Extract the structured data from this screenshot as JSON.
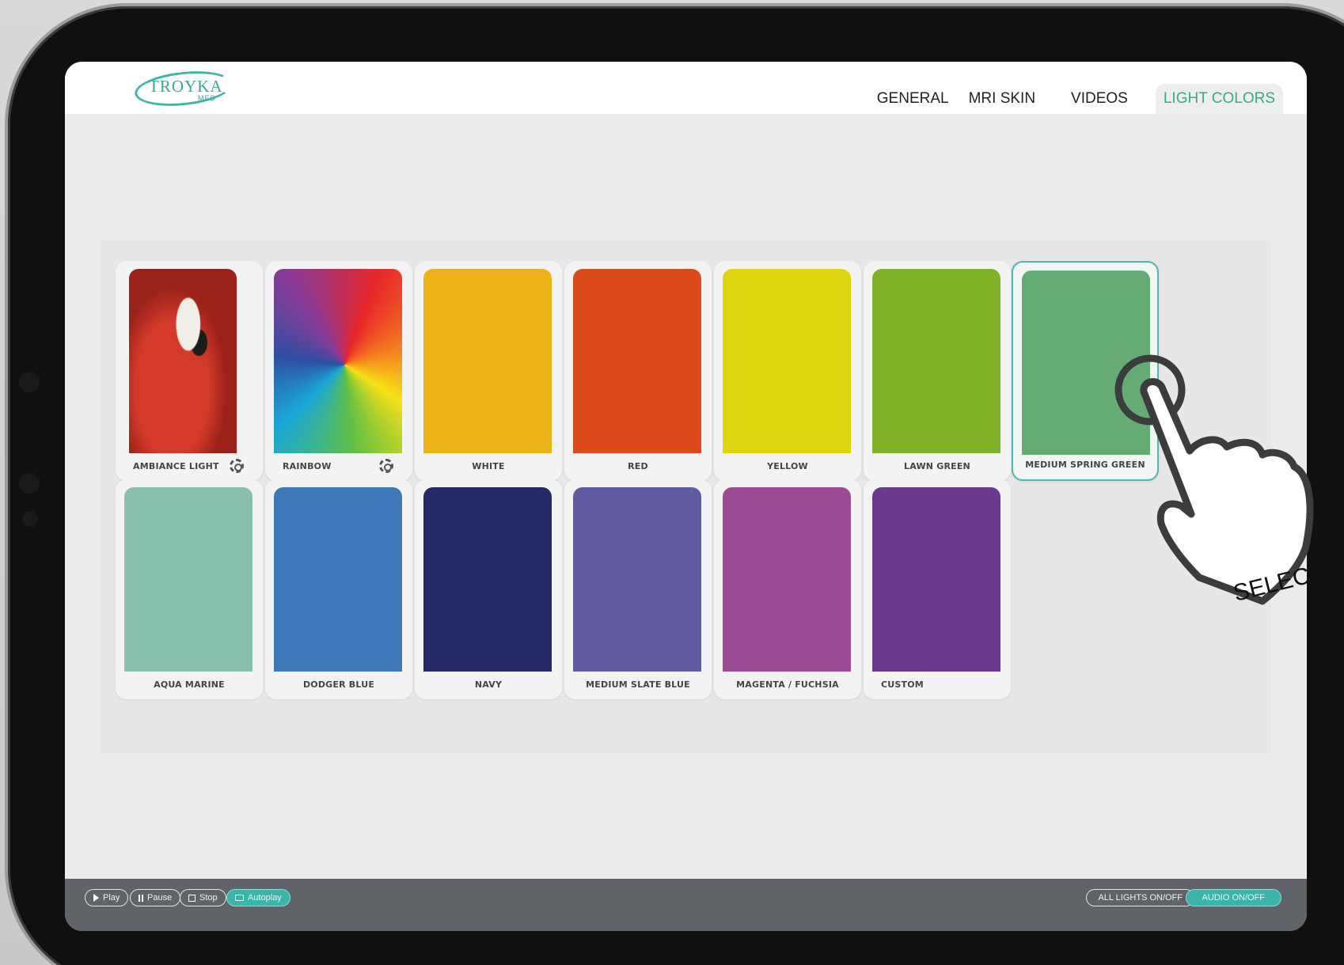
{
  "app": {
    "logo_text": "TROYKA",
    "logo_sub": "MED"
  },
  "nav": {
    "items": [
      {
        "label": "GENERAL",
        "active": false
      },
      {
        "label": "MRI SKIN",
        "active": false
      },
      {
        "label": "VIDEOS",
        "active": false
      },
      {
        "label": "LIGHT COLORS",
        "active": true
      }
    ]
  },
  "cards": [
    {
      "label": "AMBIANCE LIGHT",
      "color": "#c8372b",
      "type": "image",
      "settings": true,
      "selected": false
    },
    {
      "label": "RAINBOW",
      "color": "rainbow",
      "type": "gradient",
      "settings": true,
      "selected": false
    },
    {
      "label": "WHITE",
      "color": "#ebb317",
      "type": "solid",
      "settings": false,
      "selected": false
    },
    {
      "label": "RED",
      "color": "#db4a1a",
      "type": "solid",
      "settings": false,
      "selected": false
    },
    {
      "label": "YELLOW",
      "color": "#ddd50e",
      "type": "solid",
      "settings": false,
      "selected": false
    },
    {
      "label": "LAWN GREEN",
      "color": "#7fb229",
      "type": "solid",
      "settings": false,
      "selected": false
    },
    {
      "label": "MEDIUM SPRING GREEN",
      "color": "#64ac74",
      "type": "solid",
      "settings": false,
      "selected": true
    },
    {
      "label": "AQUA MARINE",
      "color": "#89c0ad",
      "type": "solid",
      "settings": false,
      "selected": false
    },
    {
      "label": "DODGER BLUE",
      "color": "#3e78b9",
      "type": "solid",
      "settings": false,
      "selected": false
    },
    {
      "label": "NAVY",
      "color": "#252a66",
      "type": "solid",
      "settings": false,
      "selected": false
    },
    {
      "label": "MEDIUM SLATE BLUE",
      "color": "#615ba2",
      "type": "solid",
      "settings": false,
      "selected": false
    },
    {
      "label": "MAGENTA / FUCHSIA",
      "color": "#9b4b93",
      "type": "solid",
      "settings": false,
      "selected": false
    },
    {
      "label": "CUSTOM",
      "color": "#6c398c",
      "type": "solid",
      "settings": false,
      "selected": false
    }
  ],
  "controls": {
    "play": "Play",
    "pause": "Pause",
    "stop": "Stop",
    "autoplay": "Autoplay",
    "all_lights": "ALL LIGHTS ON/OFF",
    "audio": "AUDIO ON/OFF"
  },
  "overlay": {
    "select_text": "SELEC"
  },
  "colors": {
    "accent": "#3cb4a8",
    "nav_active": "#2fb27a",
    "bottom_bar": "#606468"
  }
}
